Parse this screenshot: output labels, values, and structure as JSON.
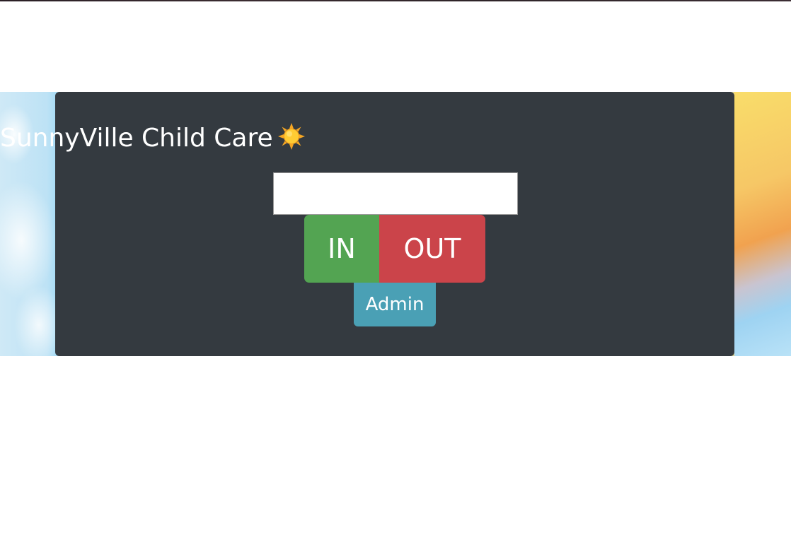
{
  "app": {
    "title": "SunnyVille Child Care",
    "title_icon": "sun-icon"
  },
  "checkin_form": {
    "code_input_value": "",
    "code_input_placeholder": "",
    "in_label": "IN",
    "out_label": "OUT",
    "admin_label": "Admin"
  },
  "colors": {
    "card_background": "#343a40",
    "in_button": "#53a452",
    "out_button": "#cb444a",
    "admin_button": "#4aa0b5"
  }
}
